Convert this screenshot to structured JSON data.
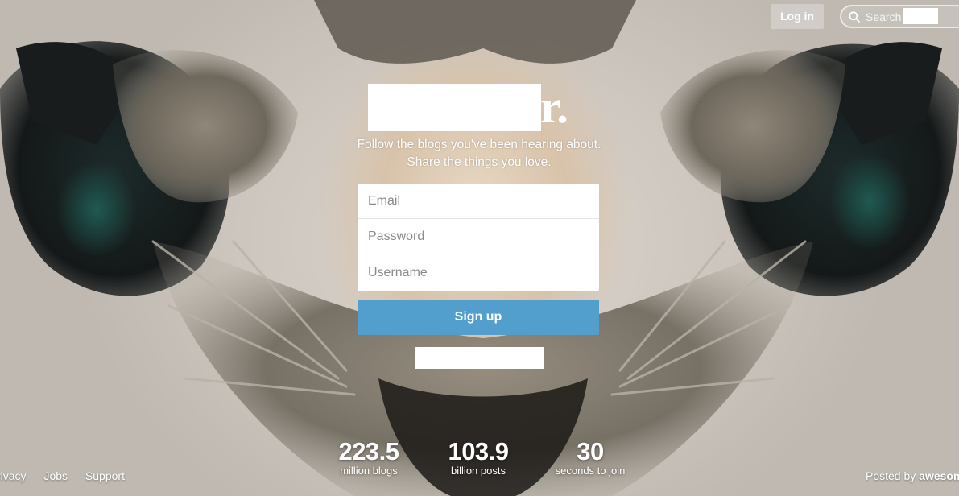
{
  "header": {
    "login_label": "Log in",
    "search_placeholder": "Search"
  },
  "hero": {
    "logo_suffix": "r.",
    "tagline_line1": "Follow the blogs you've been hearing about.",
    "tagline_line2": "Share the things you love."
  },
  "form": {
    "email_placeholder": "Email",
    "password_placeholder": "Password",
    "username_placeholder": "Username",
    "signup_label": "Sign up"
  },
  "stats": [
    {
      "value": "223.5",
      "label": "million blogs"
    },
    {
      "value": "103.9",
      "label": "billion posts"
    },
    {
      "value": "30",
      "label": "seconds to join"
    }
  ],
  "footer": {
    "links": [
      "rivacy",
      "Jobs",
      "Support"
    ],
    "posted_by_prefix": "Posted by",
    "posted_by_name": "awesom"
  },
  "colors": {
    "signup_button": "#529ecc",
    "text": "#ffffff"
  }
}
